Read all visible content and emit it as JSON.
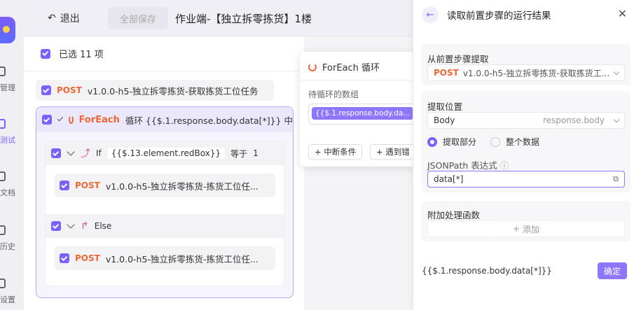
{
  "rail": {
    "items": [
      {
        "label": "管理",
        "active": false
      },
      {
        "label": "测试",
        "active": true
      },
      {
        "label": "文档",
        "active": false
      },
      {
        "label": "历史",
        "active": false
      },
      {
        "label": "设置",
        "active": false
      }
    ]
  },
  "topbar": {
    "back_label": "退出",
    "save_all_label": "全部保存",
    "title": "作业端-【独立拆零拣货】1楼"
  },
  "tree": {
    "selected_label": "已选 11 项",
    "step1": {
      "method": "POST",
      "text": "v1.0.0-h5-独立拆零拣货-获取拣货工位任务"
    },
    "foreach": {
      "label": "ForEach",
      "text": "循环 {{$.1.response.body.data[*]}} 中"
    },
    "if_branch": {
      "label": "If",
      "expr": "{{$.13.element.redBox}}",
      "op": "等于",
      "value": "1"
    },
    "if_step": {
      "method": "POST",
      "text": "v1.0.0-h5-独立拆零拣货-拣货工位任..."
    },
    "else_branch": {
      "label": "Else"
    },
    "else_step": {
      "method": "POST",
      "text": "v1.0.0-h5-独立拆零拣货-拣货工位任..."
    }
  },
  "popover": {
    "title": "ForEach 循环",
    "array_label": "待循环的数组",
    "array_tag": "{{$.1.response.body.da...",
    "btn_break": "中断条件",
    "btn_error": "遇到错"
  },
  "drawer": {
    "title": "读取前置步骤的运行结果",
    "source_label": "从前置步骤提取",
    "source_method": "POST",
    "source_value": "v1.0.0-h5-独立拆零拣货-获取拣货工...",
    "position_label": "提取位置",
    "position_value": "Body",
    "position_path": "response.body",
    "radio_part": "提取部分",
    "radio_all": "整个数据",
    "jsonpath_label": "JSONPath 表达式",
    "jsonpath_value": "data[*]",
    "postproc_label": "附加处理函数",
    "add_label": "添加",
    "result": "{{$.1.response.body.data[*]}}",
    "confirm_label": "确定"
  },
  "colors": {
    "accent": "#7b61ff",
    "post": "#ee6633"
  }
}
